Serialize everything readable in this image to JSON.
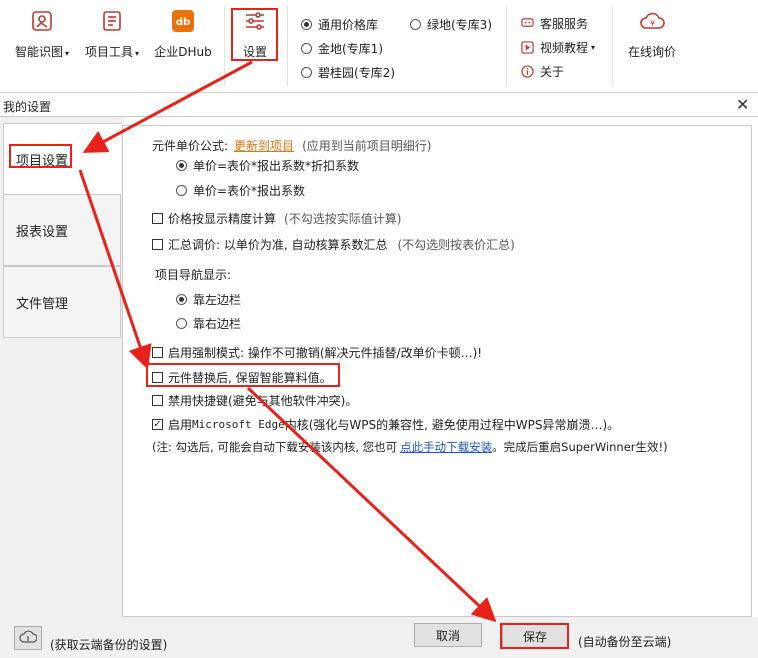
{
  "ribbon": {
    "buttons": [
      {
        "label": "智能识图",
        "icon": "image-recognition-icon",
        "dropdown": true
      },
      {
        "label": "项目工具",
        "icon": "project-tools-icon",
        "dropdown": true
      },
      {
        "label": "企业DHub",
        "icon": "dhub-logo-icon",
        "dropdown": false
      },
      {
        "label": "设置",
        "icon": "settings-sliders-icon",
        "dropdown": false
      }
    ],
    "price_libs": [
      {
        "label": "通用价格库",
        "selected": true
      },
      {
        "label": "绿地(专库3)",
        "selected": false
      },
      {
        "label": "金地(专库1)",
        "selected": false
      },
      {
        "label": "碧桂园(专库2)",
        "selected": false
      }
    ],
    "help_menu": {
      "service": "客服服务",
      "video": "视频教程",
      "about": "关于"
    },
    "inquiry": "在线询价"
  },
  "dialog": {
    "title": "我的设置",
    "close": "✕",
    "tabs": [
      "项目设置",
      "报表设置",
      "文件管理"
    ],
    "settings": {
      "unit_price_label": "元件单价公式:",
      "update_link": "更新到项目",
      "update_hint": "(应用到当前项目明细行)",
      "formula_options": [
        {
          "label": "单价=表价*报出系数*折扣系数",
          "selected": true
        },
        {
          "label": "单价=表价*报出系数",
          "selected": false
        }
      ],
      "precision": {
        "label": "价格按显示精度计算",
        "hint": "(不勾选按实际值计算)",
        "checked": false
      },
      "summary": {
        "label": "汇总调价: 以单价为准, 自动核算系数汇总",
        "hint": "(不勾选则按表价汇总)",
        "checked": false
      },
      "nav_label": "项目导航显示:",
      "nav_options": [
        {
          "label": "靠左边栏",
          "selected": true
        },
        {
          "label": "靠右边栏",
          "selected": false
        }
      ],
      "force_mode": {
        "label": "启用强制模式: 操作不可撤销(解决元件插替/改单价卡顿…)!",
        "checked": false
      },
      "keep_calc": {
        "label": "元件替换后, 保留智能算料值。",
        "checked": false
      },
      "disable_shortcut": {
        "label": "禁用快捷键(避免与其他软件冲突)。",
        "checked": false
      },
      "edge_kernel": {
        "label_pre": "启用",
        "label_mono": "Microsoft Edge",
        "label_post": "内核(强化与WPS的兼容性, 避免使用过程中WPS异常崩溃…)。",
        "checked": true
      },
      "note_pre": "(注: 勾选后, 可能会自动下载安装该内核, 您也可",
      "note_link": "点此手动下载安装",
      "note_post": "。完成后重启SuperWinner生效!)"
    },
    "footer": {
      "cloud_hint": "(获取云端备份的设置)",
      "cancel": "取消",
      "save": "保存",
      "auto_backup": "(自动备份至云端)"
    }
  },
  "colors": {
    "annotation_red": "#e8221a",
    "link_orange": "#e8720c",
    "link_blue": "#1a55c8"
  }
}
